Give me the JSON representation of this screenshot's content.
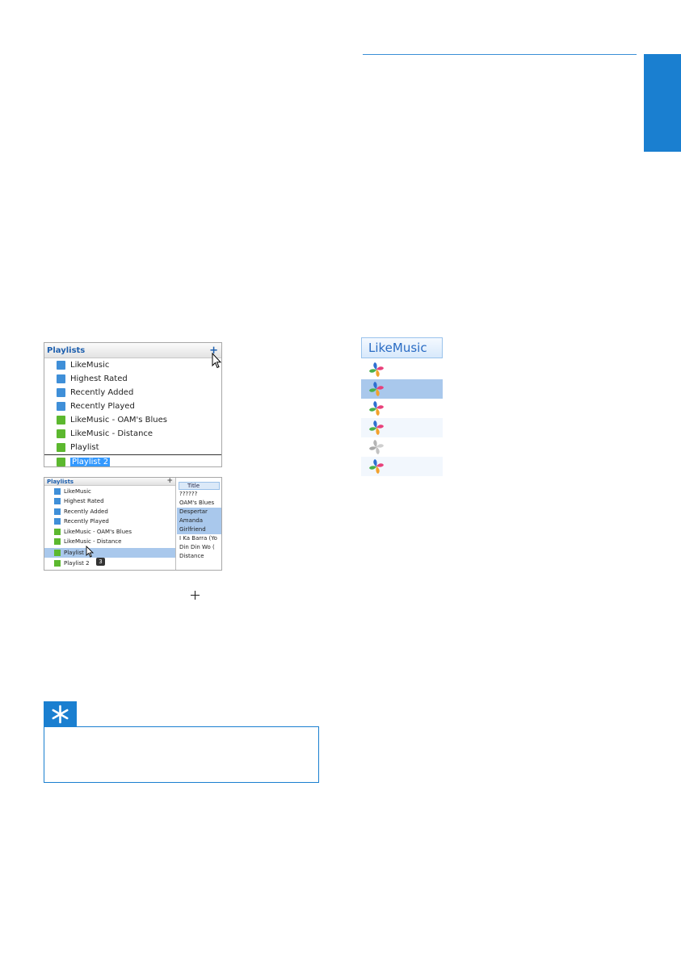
{
  "screenshot1": {
    "header": "Playlists",
    "plus": "+",
    "items": [
      {
        "label": "LikeMusic",
        "icon": "folder-icon"
      },
      {
        "label": "Highest Rated",
        "icon": "smart-playlist-icon"
      },
      {
        "label": "Recently Added",
        "icon": "smart-playlist-icon"
      },
      {
        "label": "Recently Played",
        "icon": "smart-playlist-icon"
      },
      {
        "label": "LikeMusic - OAM's Blues",
        "icon": "playlist-icon"
      },
      {
        "label": "LikeMusic - Distance",
        "icon": "playlist-icon"
      },
      {
        "label": "Playlist",
        "icon": "playlist-icon"
      },
      {
        "label": "Playlist 2",
        "icon": "playlist-icon"
      }
    ]
  },
  "screenshot2": {
    "header": "Playlists",
    "plus": "+",
    "items": [
      {
        "label": "LikeMusic"
      },
      {
        "label": "Highest Rated"
      },
      {
        "label": "Recently Added"
      },
      {
        "label": "Recently Played"
      },
      {
        "label": "LikeMusic - OAM's Blues"
      },
      {
        "label": "LikeMusic - Distance"
      },
      {
        "label": "Playlist"
      },
      {
        "label": "Playlist 2"
      }
    ],
    "column_header": "Title",
    "songs": [
      "??????",
      "OAM's Blues",
      "Despertar",
      "Amanda",
      "Girlfriend",
      "I Ka Barra (Yo",
      "Din Din Wo (",
      "Distance"
    ],
    "drag_count": "3"
  },
  "likemusic_panel": {
    "header": "LikeMusic"
  },
  "colors": {
    "accent": "#1a7fd0",
    "selection": "#a9c8ec"
  }
}
